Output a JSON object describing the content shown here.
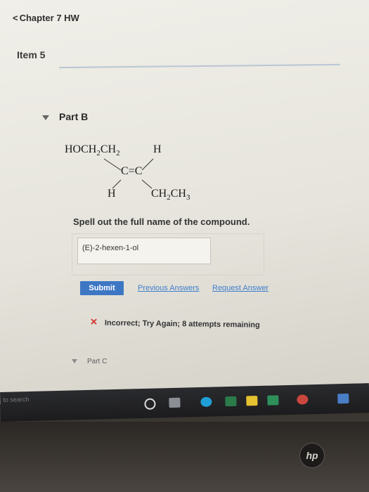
{
  "header": {
    "back_glyph": "<",
    "title": "Chapter 7 HW"
  },
  "item": {
    "title": "Item 5"
  },
  "part_b": {
    "label": "Part B",
    "structure": {
      "top_left": {
        "a": "HOCH",
        "s1": "2",
        "b": "CH",
        "s2": "2"
      },
      "top_right": "H",
      "center": "C=C",
      "bottom_left": "H",
      "bottom_right": {
        "a": "CH",
        "s1": "2",
        "b": "CH",
        "s2": "3"
      }
    },
    "question": "Spell out the full name of the compound.",
    "answer_value": "(E)-2-hexen-1-ol",
    "submit_label": "Submit",
    "previous_answers_label": "Previous Answers",
    "request_answer_label": "Request Answer",
    "feedback": {
      "icon": "✕",
      "text": "Incorrect; Try Again; 8 attempts remaining"
    }
  },
  "part_c": {
    "label": "Part C"
  },
  "taskbar": {
    "search_text": "to search"
  },
  "colors": {
    "submit_bg": "#3d77c4",
    "link": "#3f7fce",
    "error_x": "#d5342c"
  },
  "brand": {
    "logo_text": "hp"
  }
}
